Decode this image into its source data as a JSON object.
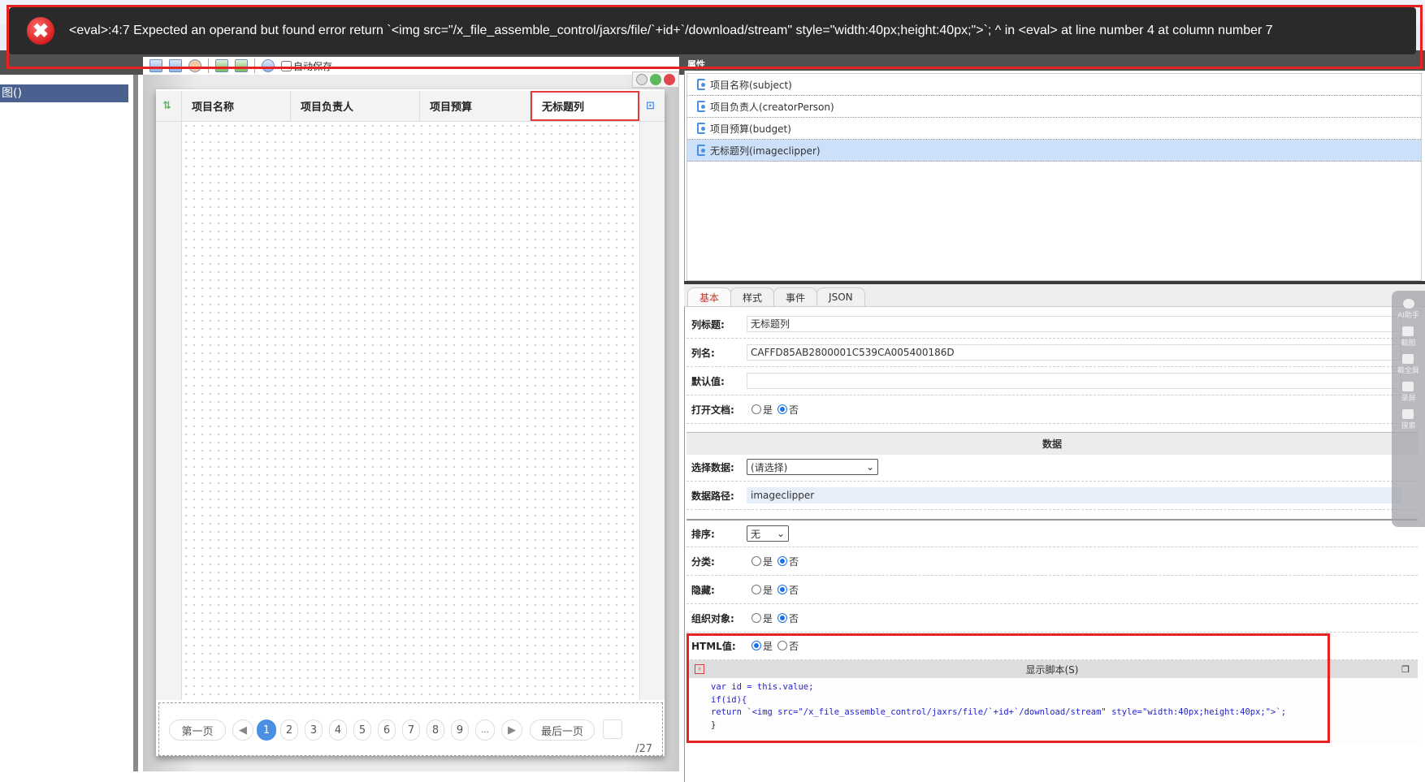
{
  "error_toast": {
    "message": "<eval>:4:7 Expected an operand but found error return `<img src=\"/x_file_assemble_control/jaxrs/file/`+id+`/download/stream\" style=\"width:40px;height:40px;\">`; ^ in <eval> at line number 4 at column number 7"
  },
  "left_panel": {
    "selected_item": "图()"
  },
  "toolbar": {
    "autosave_label": "自动保存"
  },
  "table": {
    "columns": [
      "项目名称",
      "项目负责人",
      "项目预算",
      "无标题列"
    ],
    "selected_column": "无标题列"
  },
  "pager": {
    "first": "第一页",
    "last": "最后一页",
    "pages": [
      "1",
      "2",
      "3",
      "4",
      "5",
      "6",
      "7",
      "8",
      "9",
      "..."
    ],
    "current": "1",
    "total": "/27"
  },
  "properties": {
    "title": "属性",
    "fields": [
      {
        "label": "项目名称(subject)",
        "selected": false
      },
      {
        "label": "项目负责人(creatorPerson)",
        "selected": false
      },
      {
        "label": "项目预算(budget)",
        "selected": false
      },
      {
        "label": "无标题列(imageclipper)",
        "selected": true
      }
    ],
    "tabs": [
      "基本",
      "样式",
      "事件",
      "JSON"
    ],
    "form": {
      "column_title_label": "列标题:",
      "column_title": "无标题列",
      "column_name_label": "列名:",
      "column_name": "CAFFD85AB2800001C539CA005400186D",
      "default_label": "默认值:",
      "default_value": "",
      "open_doc_label": "打开文档:",
      "yes": "是",
      "no": "否",
      "data_section": "数据",
      "select_data_label": "选择数据:",
      "select_data": "(请选择)",
      "data_path_label": "数据路径:",
      "data_path": "imageclipper",
      "sort_label": "排序:",
      "sort": "无",
      "group_label": "分类:",
      "hidden_label": "隐藏:",
      "org_label": "组织对象:",
      "html_label": "HTML值:"
    },
    "script": {
      "title": "显示脚本(S)",
      "lines": [
        "var id = this.value;",
        "if(id){",
        "return `<img src=\"/x_file_assemble_control/jaxrs/file/`+id+`/download/stream\" style=\"width:40px;height:40px;\">`;",
        "}"
      ]
    }
  },
  "float_toolbar": [
    "AI助手",
    "截图",
    "截全屏",
    "录屏",
    "搜索"
  ]
}
